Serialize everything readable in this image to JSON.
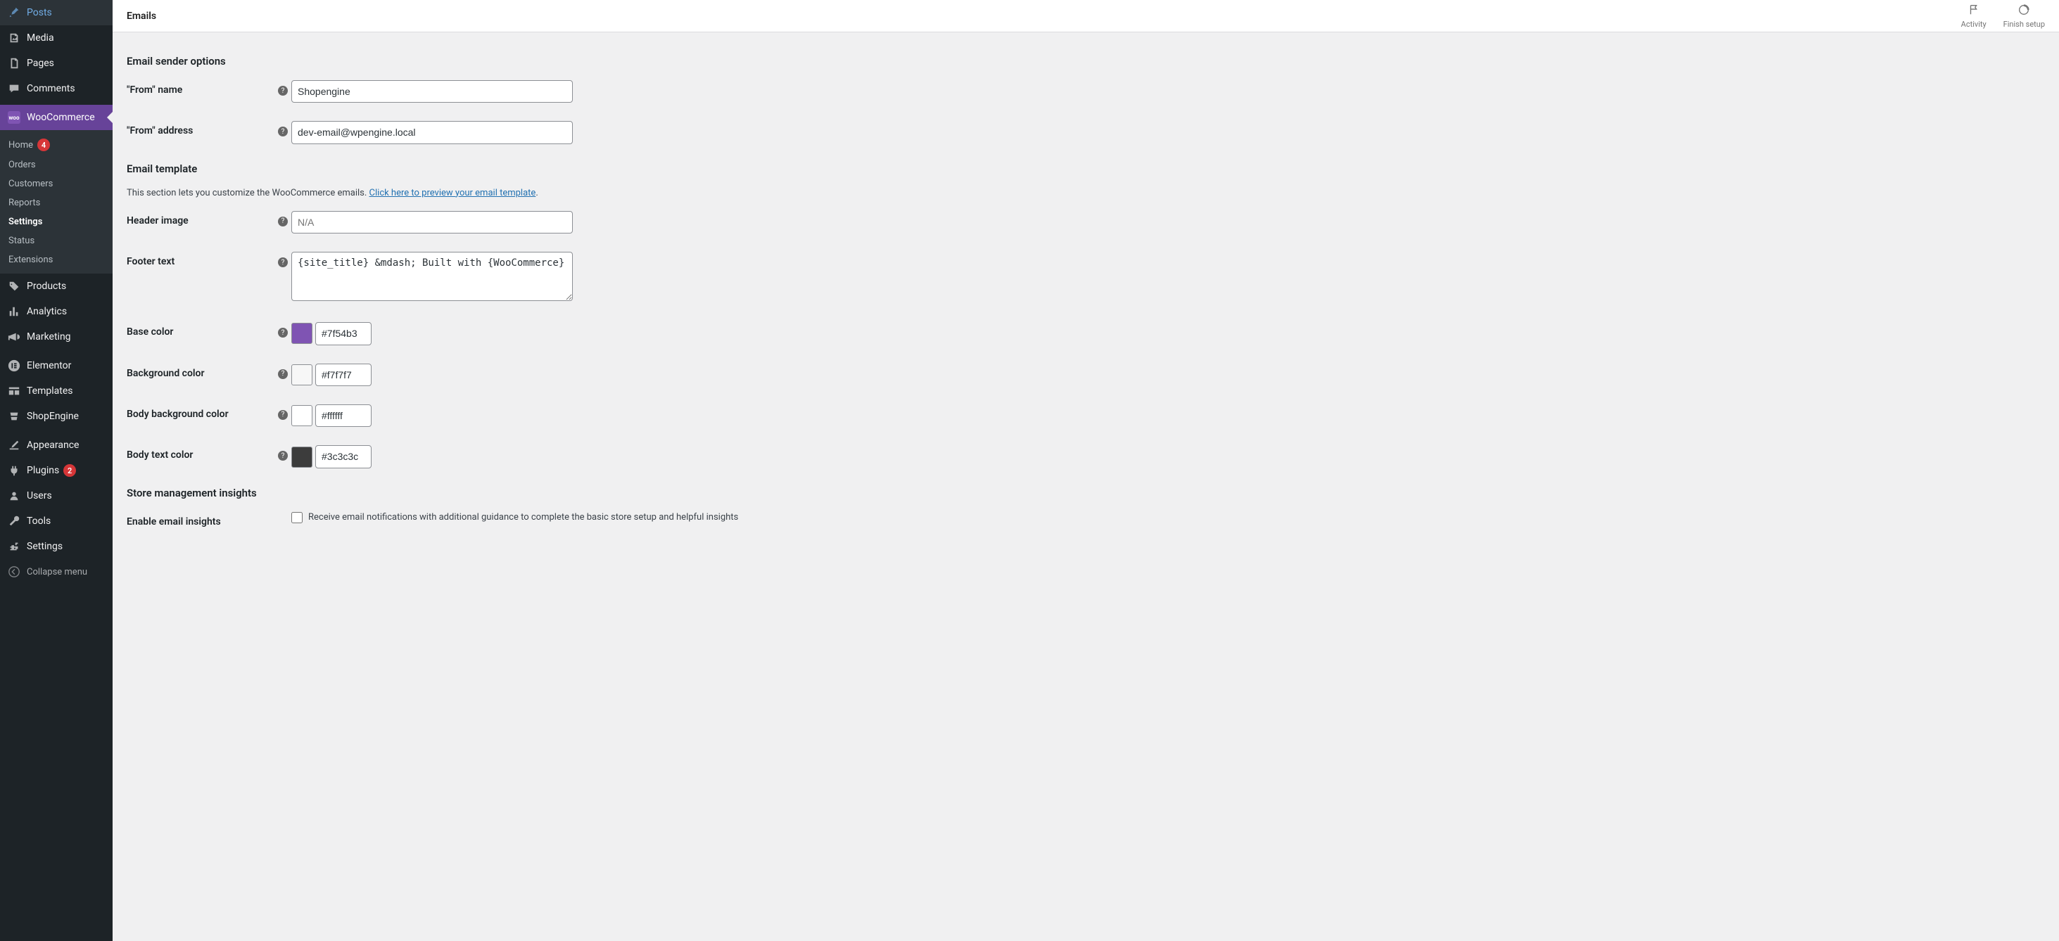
{
  "topbar": {
    "title": "Emails",
    "activity": "Activity",
    "finish_setup": "Finish setup"
  },
  "sidebar": {
    "posts": "Posts",
    "media": "Media",
    "pages": "Pages",
    "comments": "Comments",
    "woocommerce": "WooCommerce",
    "submenu": {
      "home": "Home",
      "home_badge": "4",
      "orders": "Orders",
      "customers": "Customers",
      "reports": "Reports",
      "settings": "Settings",
      "status": "Status",
      "extensions": "Extensions"
    },
    "products": "Products",
    "analytics": "Analytics",
    "marketing": "Marketing",
    "elementor": "Elementor",
    "templates": "Templates",
    "shopengine": "ShopEngine",
    "appearance": "Appearance",
    "plugins": "Plugins",
    "plugins_badge": "2",
    "users": "Users",
    "tools": "Tools",
    "settings_main": "Settings",
    "collapse": "Collapse menu"
  },
  "sections": {
    "sender": "Email sender options",
    "template": "Email template",
    "template_desc": "This section lets you customize the WooCommerce emails. ",
    "template_link": "Click here to preview your email template",
    "insights": "Store management insights"
  },
  "fields": {
    "from_name": {
      "label": "\"From\" name",
      "value": "Shopengine"
    },
    "from_address": {
      "label": "\"From\" address",
      "value": "dev-email@wpengine.local"
    },
    "header_image": {
      "label": "Header image",
      "placeholder": "N/A",
      "value": ""
    },
    "footer_text": {
      "label": "Footer text",
      "value": "{site_title} &mdash; Built with {WooCommerce}"
    },
    "base_color": {
      "label": "Base color",
      "value": "#7f54b3",
      "swatch": "#7f54b3"
    },
    "bg_color": {
      "label": "Background color",
      "value": "#f7f7f7",
      "swatch": "#f7f7f7"
    },
    "body_bg_color": {
      "label": "Body background color",
      "value": "#ffffff",
      "swatch": "#ffffff"
    },
    "body_text_color": {
      "label": "Body text color",
      "value": "#3c3c3c",
      "swatch": "#3c3c3c"
    },
    "insights_enable": {
      "label": "Enable email insights",
      "desc": "Receive email notifications with additional guidance to complete the basic store setup and helpful insights"
    }
  }
}
